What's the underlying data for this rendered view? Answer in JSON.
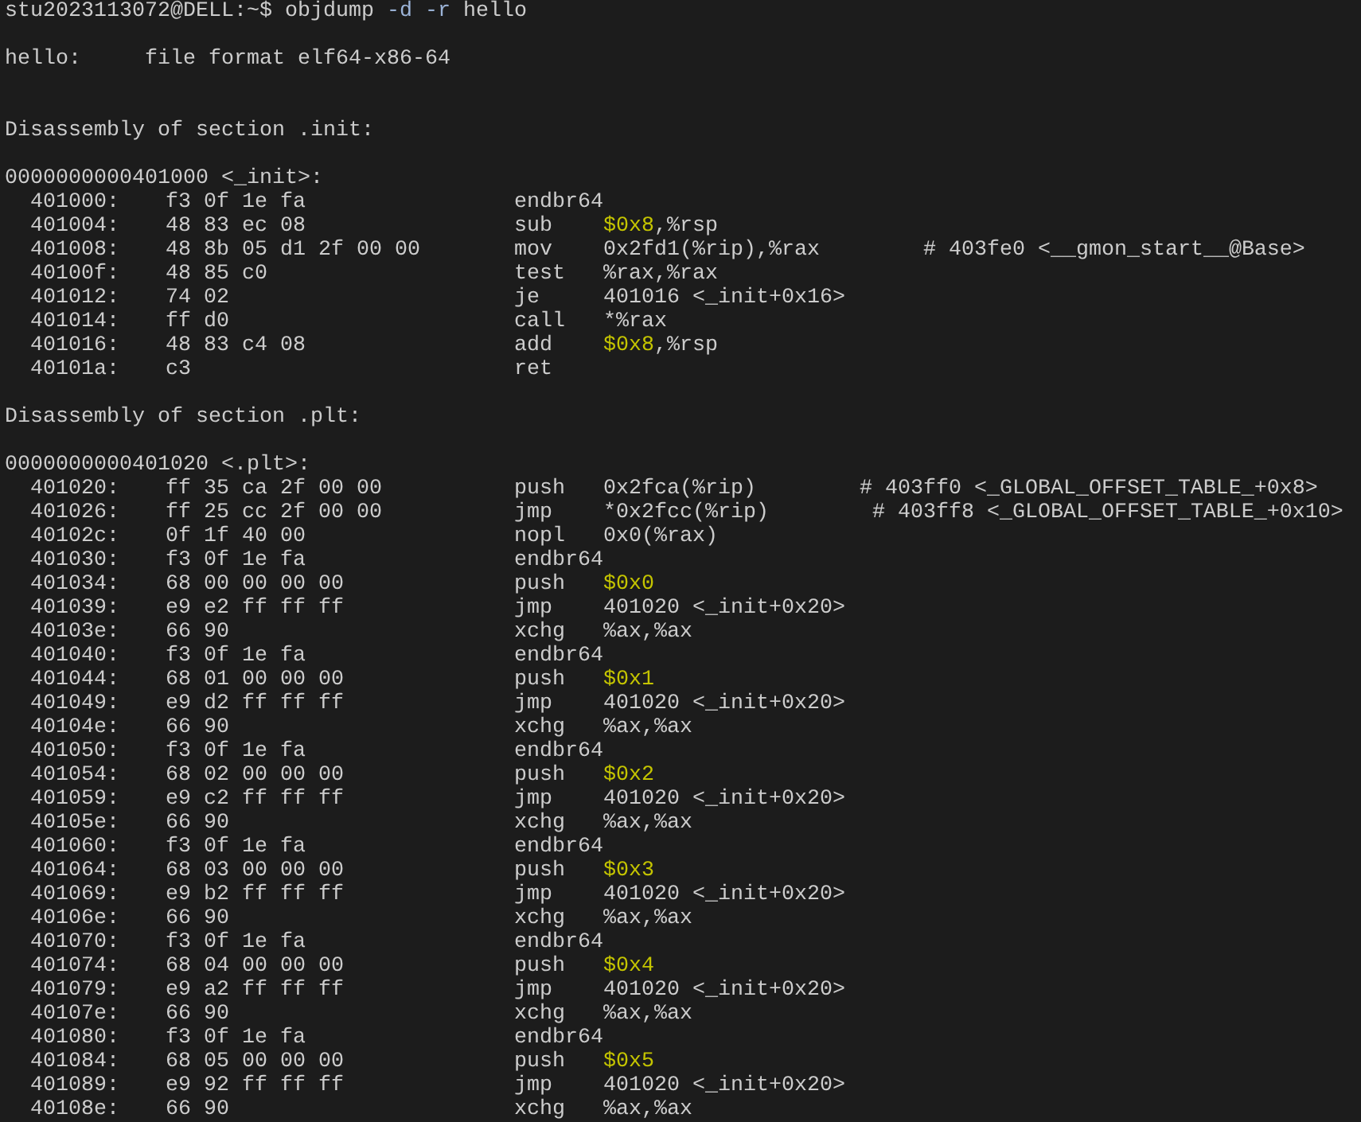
{
  "prompt": {
    "user_host": "stu2023113072@DELL:~$",
    "command": [
      {
        "text": "objdump",
        "kind": "plain"
      },
      {
        "text": " -d -r",
        "kind": "flag"
      },
      {
        "text": " hello",
        "kind": "plain"
      }
    ]
  },
  "file_info": {
    "file": "hello:",
    "format": "file format elf64-x86-64"
  },
  "sections": [
    {
      "heading": "Disassembly of section .init:",
      "symbol_address": "0000000000401000",
      "symbol": "<_init>:",
      "instructions": [
        {
          "address": "401000:",
          "bytes": "f3 0f 1e fa",
          "mnemonic": "endbr64"
        },
        {
          "address": "401004:",
          "bytes": "48 83 ec 08",
          "mnemonic": "sub",
          "operands": [
            {
              "text": "$0x8",
              "kind": "immediate"
            },
            {
              "text": ",%rsp",
              "kind": "plain"
            }
          ]
        },
        {
          "address": "401008:",
          "bytes": "48 8b 05 d1 2f 00 00",
          "mnemonic": "mov",
          "operands": [
            {
              "text": "0x2fd1(%rip),%rax",
              "kind": "plain"
            }
          ],
          "comment": "# 403fe0 <__gmon_start__@Base>"
        },
        {
          "address": "40100f:",
          "bytes": "48 85 c0",
          "mnemonic": "test",
          "operands": [
            {
              "text": "%rax,%rax",
              "kind": "plain"
            }
          ]
        },
        {
          "address": "401012:",
          "bytes": "74 02",
          "mnemonic": "je",
          "operands": [
            {
              "text": "401016 <_init+0x16>",
              "kind": "plain"
            }
          ]
        },
        {
          "address": "401014:",
          "bytes": "ff d0",
          "mnemonic": "call",
          "operands": [
            {
              "text": "*%rax",
              "kind": "plain"
            }
          ]
        },
        {
          "address": "401016:",
          "bytes": "48 83 c4 08",
          "mnemonic": "add",
          "operands": [
            {
              "text": "$0x8",
              "kind": "immediate"
            },
            {
              "text": ",%rsp",
              "kind": "plain"
            }
          ]
        },
        {
          "address": "40101a:",
          "bytes": "c3",
          "mnemonic": "ret"
        }
      ]
    },
    {
      "heading": "Disassembly of section .plt:",
      "symbol_address": "0000000000401020",
      "symbol": "<.plt>:",
      "instructions": [
        {
          "address": "401020:",
          "bytes": "ff 35 ca 2f 00 00",
          "mnemonic": "push",
          "operands": [
            {
              "text": "0x2fca(%rip)",
              "kind": "plain"
            }
          ],
          "comment": "# 403ff0 <_GLOBAL_OFFSET_TABLE_+0x8>"
        },
        {
          "address": "401026:",
          "bytes": "ff 25 cc 2f 00 00",
          "mnemonic": "jmp",
          "operands": [
            {
              "text": "*0x2fcc(%rip)",
              "kind": "plain"
            }
          ],
          "comment": "# 403ff8 <_GLOBAL_OFFSET_TABLE_+0x10>"
        },
        {
          "address": "40102c:",
          "bytes": "0f 1f 40 00",
          "mnemonic": "nopl",
          "operands": [
            {
              "text": "0x0(%rax)",
              "kind": "plain"
            }
          ]
        },
        {
          "address": "401030:",
          "bytes": "f3 0f 1e fa",
          "mnemonic": "endbr64"
        },
        {
          "address": "401034:",
          "bytes": "68 00 00 00 00",
          "mnemonic": "push",
          "operands": [
            {
              "text": "$0x0",
              "kind": "immediate"
            }
          ]
        },
        {
          "address": "401039:",
          "bytes": "e9 e2 ff ff ff",
          "mnemonic": "jmp",
          "operands": [
            {
              "text": "401020 <_init+0x20>",
              "kind": "plain"
            }
          ]
        },
        {
          "address": "40103e:",
          "bytes": "66 90",
          "mnemonic": "xchg",
          "operands": [
            {
              "text": "%ax,%ax",
              "kind": "plain"
            }
          ]
        },
        {
          "address": "401040:",
          "bytes": "f3 0f 1e fa",
          "mnemonic": "endbr64"
        },
        {
          "address": "401044:",
          "bytes": "68 01 00 00 00",
          "mnemonic": "push",
          "operands": [
            {
              "text": "$0x1",
              "kind": "immediate"
            }
          ]
        },
        {
          "address": "401049:",
          "bytes": "e9 d2 ff ff ff",
          "mnemonic": "jmp",
          "operands": [
            {
              "text": "401020 <_init+0x20>",
              "kind": "plain"
            }
          ]
        },
        {
          "address": "40104e:",
          "bytes": "66 90",
          "mnemonic": "xchg",
          "operands": [
            {
              "text": "%ax,%ax",
              "kind": "plain"
            }
          ]
        },
        {
          "address": "401050:",
          "bytes": "f3 0f 1e fa",
          "mnemonic": "endbr64"
        },
        {
          "address": "401054:",
          "bytes": "68 02 00 00 00",
          "mnemonic": "push",
          "operands": [
            {
              "text": "$0x2",
              "kind": "immediate"
            }
          ]
        },
        {
          "address": "401059:",
          "bytes": "e9 c2 ff ff ff",
          "mnemonic": "jmp",
          "operands": [
            {
              "text": "401020 <_init+0x20>",
              "kind": "plain"
            }
          ]
        },
        {
          "address": "40105e:",
          "bytes": "66 90",
          "mnemonic": "xchg",
          "operands": [
            {
              "text": "%ax,%ax",
              "kind": "plain"
            }
          ]
        },
        {
          "address": "401060:",
          "bytes": "f3 0f 1e fa",
          "mnemonic": "endbr64"
        },
        {
          "address": "401064:",
          "bytes": "68 03 00 00 00",
          "mnemonic": "push",
          "operands": [
            {
              "text": "$0x3",
              "kind": "immediate"
            }
          ]
        },
        {
          "address": "401069:",
          "bytes": "e9 b2 ff ff ff",
          "mnemonic": "jmp",
          "operands": [
            {
              "text": "401020 <_init+0x20>",
              "kind": "plain"
            }
          ]
        },
        {
          "address": "40106e:",
          "bytes": "66 90",
          "mnemonic": "xchg",
          "operands": [
            {
              "text": "%ax,%ax",
              "kind": "plain"
            }
          ]
        },
        {
          "address": "401070:",
          "bytes": "f3 0f 1e fa",
          "mnemonic": "endbr64"
        },
        {
          "address": "401074:",
          "bytes": "68 04 00 00 00",
          "mnemonic": "push",
          "operands": [
            {
              "text": "$0x4",
              "kind": "immediate"
            }
          ]
        },
        {
          "address": "401079:",
          "bytes": "e9 a2 ff ff ff",
          "mnemonic": "jmp",
          "operands": [
            {
              "text": "401020 <_init+0x20>",
              "kind": "plain"
            }
          ]
        },
        {
          "address": "40107e:",
          "bytes": "66 90",
          "mnemonic": "xchg",
          "operands": [
            {
              "text": "%ax,%ax",
              "kind": "plain"
            }
          ]
        },
        {
          "address": "401080:",
          "bytes": "f3 0f 1e fa",
          "mnemonic": "endbr64"
        },
        {
          "address": "401084:",
          "bytes": "68 05 00 00 00",
          "mnemonic": "push",
          "operands": [
            {
              "text": "$0x5",
              "kind": "immediate"
            }
          ]
        },
        {
          "address": "401089:",
          "bytes": "e9 92 ff ff ff",
          "mnemonic": "jmp",
          "operands": [
            {
              "text": "401020 <_init+0x20>",
              "kind": "plain"
            }
          ]
        },
        {
          "address": "40108e:",
          "bytes": "66 90",
          "mnemonic": "xchg",
          "operands": [
            {
              "text": "%ax,%ax",
              "kind": "plain"
            }
          ]
        }
      ]
    }
  ]
}
